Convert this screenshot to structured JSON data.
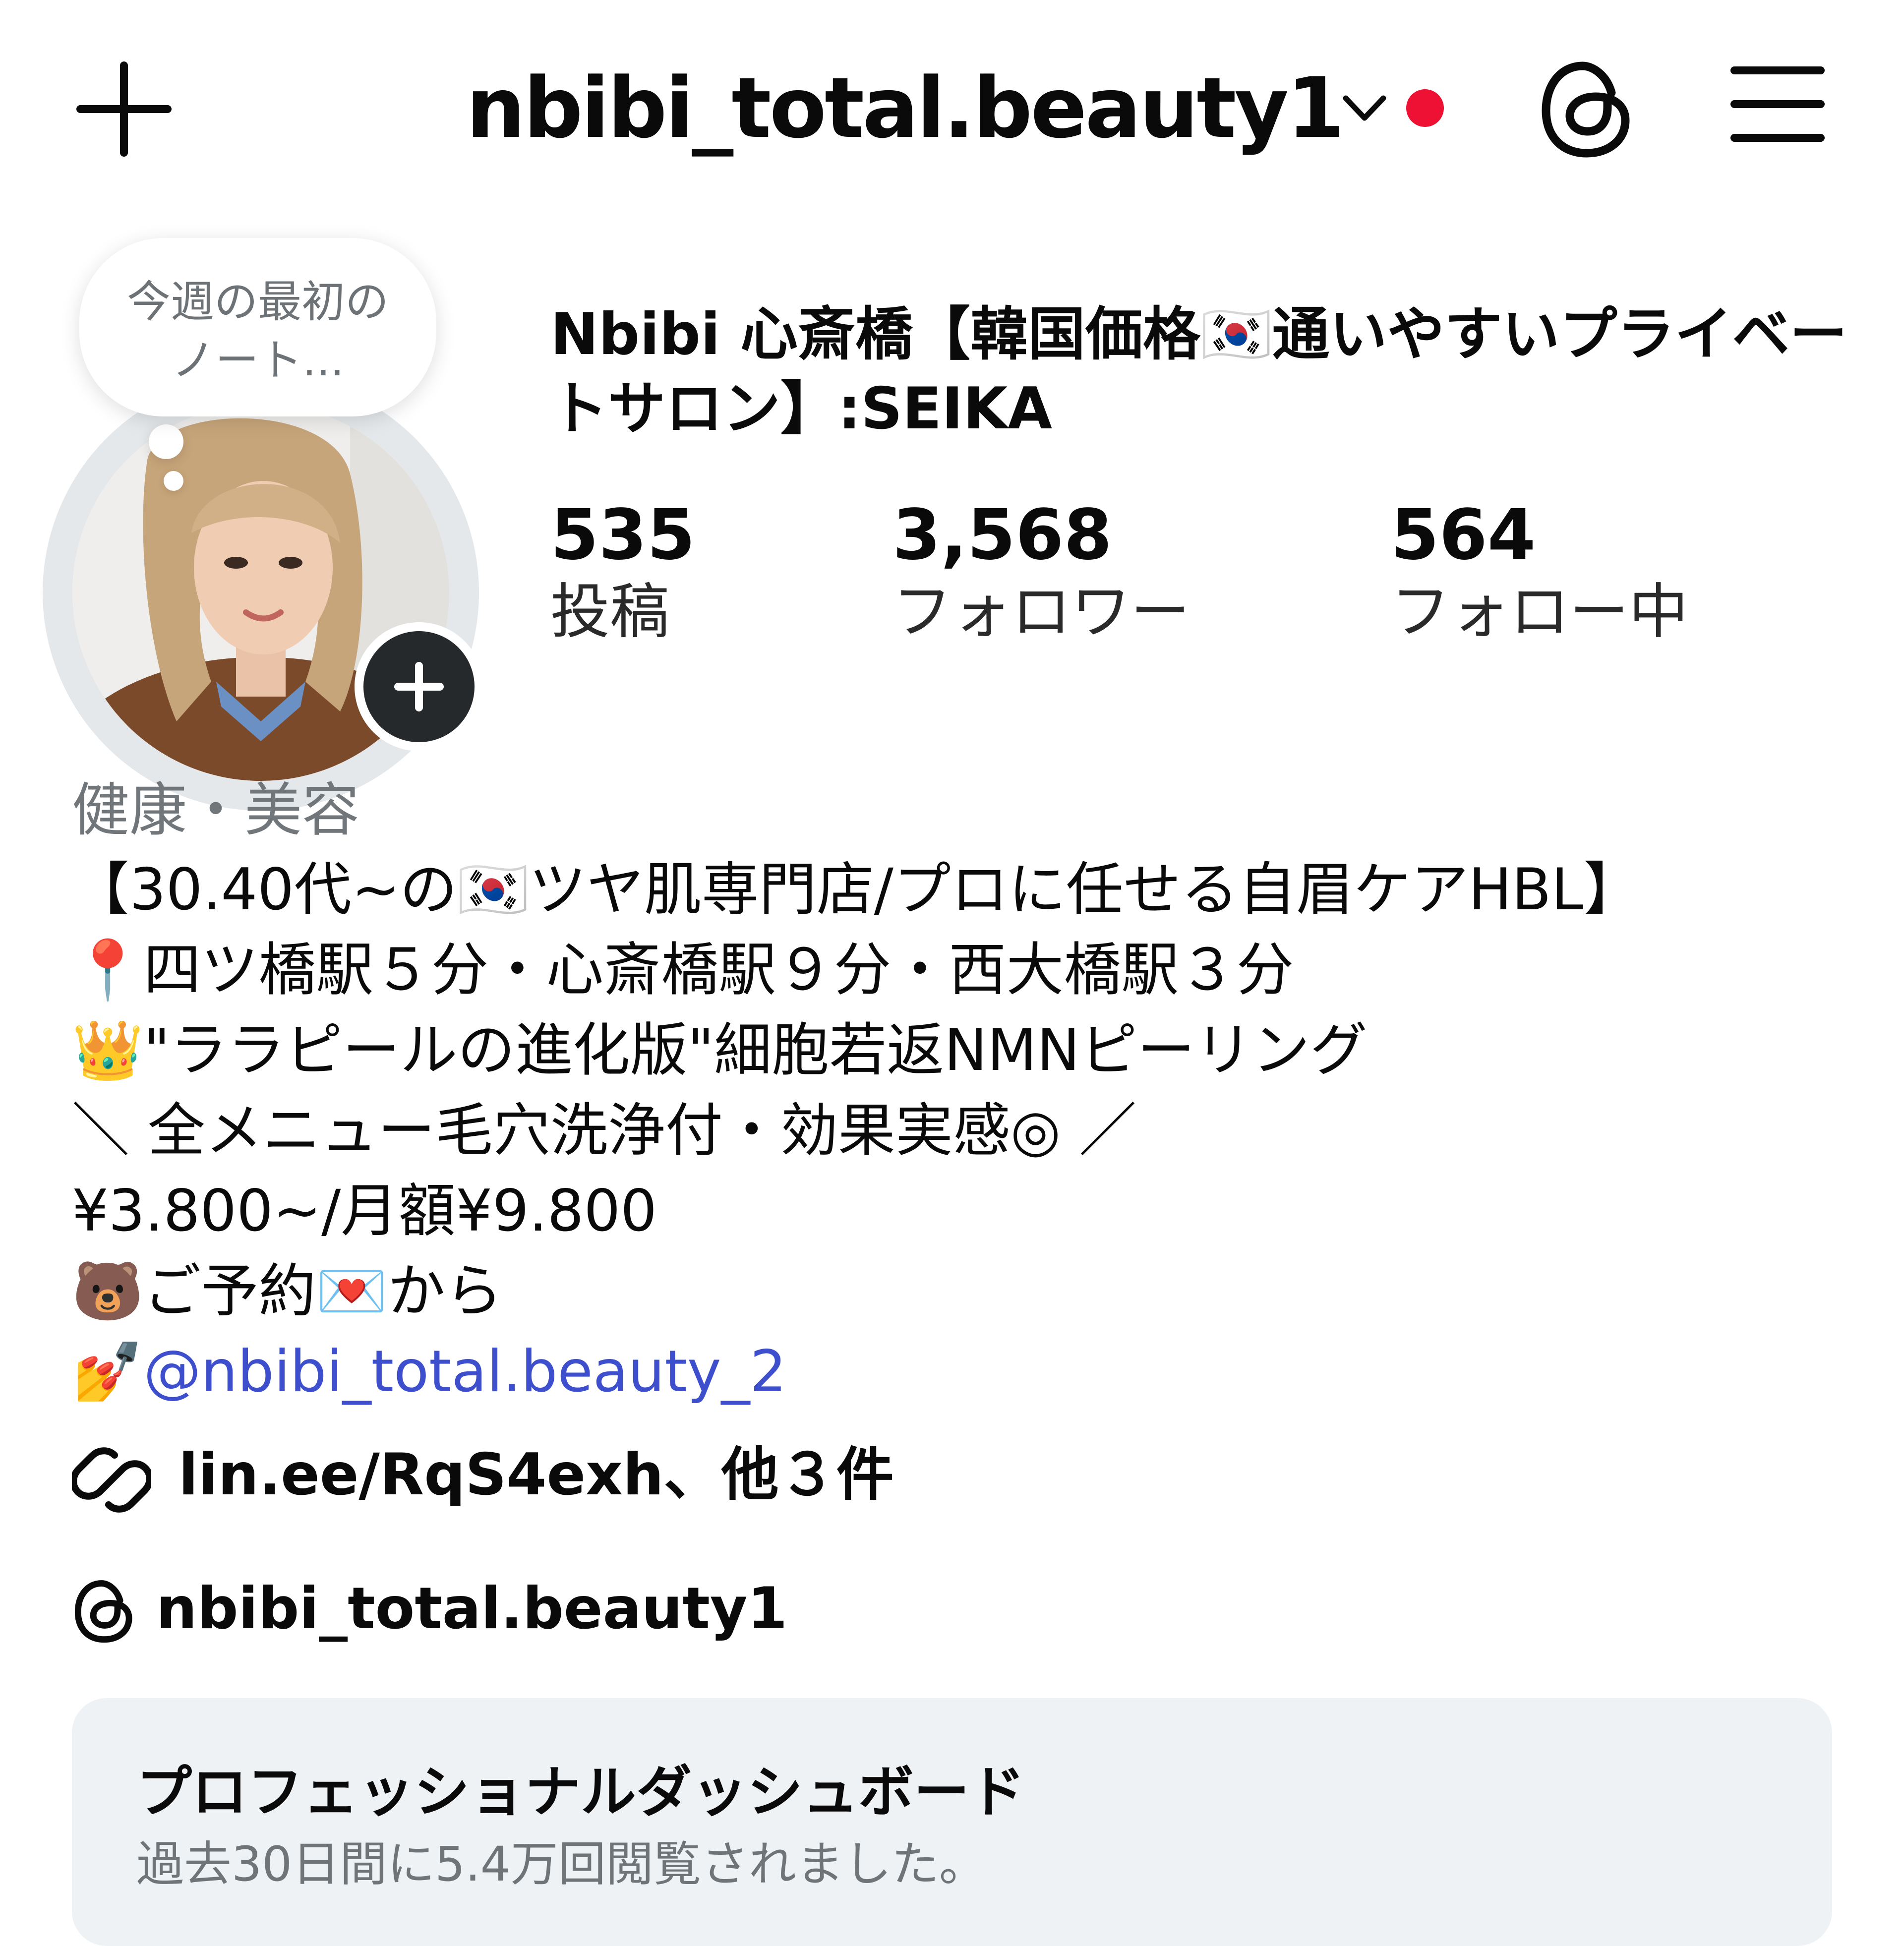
{
  "header": {
    "username": "nbibi_total.beauty1",
    "notification_color": "#ee1133",
    "icons": {
      "create": "plus-icon",
      "account_switch": "chevron-down-icon",
      "threads": "threads-icon",
      "menu": "hamburger-menu-icon"
    }
  },
  "profile": {
    "note": "今週の最初の\nノート...",
    "display_name": "Nbibi 心斎橋【韓国価格🇰🇷通いやすいプライベートサロン】:SEIKA",
    "stats": [
      {
        "value": "535",
        "label": "投稿"
      },
      {
        "value": "3,568",
        "label": "フォロワー"
      },
      {
        "value": "564",
        "label": "フォロー中"
      }
    ]
  },
  "bio": {
    "category": "健康・美容",
    "lines": [
      "【30.40代~の🇰🇷ツヤ肌専門店/プロに任せる自眉ケアHBL】",
      "📍四ツ橋駅５分・心斎橋駅９分・西大橋駅３分",
      "👑\"ララピールの進化版\"細胞若返NMNピーリング",
      "＼ 全メニュー毛穴洗浄付・効果実感◎ ／",
      "¥3.800~/月額¥9.800",
      "🐻ご予約💌から"
    ],
    "mention_emoji": "💅",
    "mention": "@nbibi_total.beauty_2",
    "link_color": "#3d4fcc",
    "link": "lin.ee/RqS4exh、他３件",
    "threads_handle": "nbibi_total.beauty1"
  },
  "dashboard": {
    "title": "プロフェッショナルダッシュボード",
    "subtitle": "過去30日間に5.4万回閲覧されました。"
  }
}
